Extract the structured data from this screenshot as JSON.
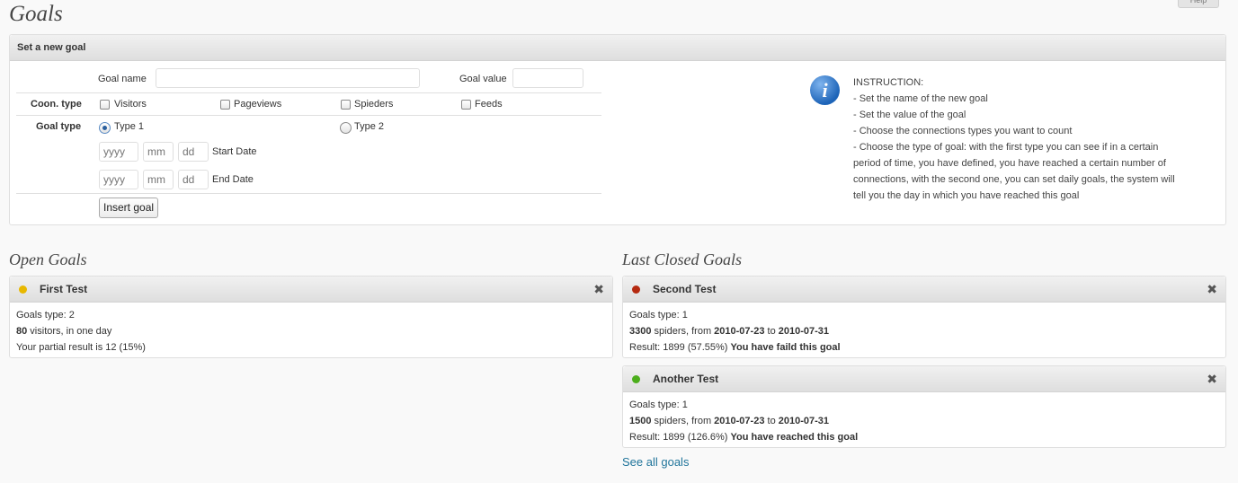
{
  "help_label": "Help",
  "page_title": "Goals",
  "new_goal": {
    "title": "Set a new goal",
    "goal_name_label": "Goal name",
    "goal_name_value": "",
    "goal_value_label": "Goal value",
    "goal_value_value": "",
    "conn_type_label": "Coon. type",
    "conn_types": [
      "Visitors",
      "Pageviews",
      "Spieders",
      "Feeds"
    ],
    "goal_type_label": "Goal type",
    "goal_types": [
      "Type 1",
      "Type 2"
    ],
    "selected_goal_type": "Type 1",
    "date_placeholders": {
      "year": "yyyy",
      "month": "mm",
      "day": "dd"
    },
    "start_date_label": "Start Date",
    "end_date_label": "End Date",
    "insert_button": "Insert goal",
    "instructions": [
      "INSTRUCTION:",
      "- Set the name of the new goal",
      "- Set the value of the goal",
      "- Choose the connections types you want to count",
      "- Choose the type of goal: with the first type you can see if in a certain",
      "period of time, you have defined, you have reached a certain number of",
      "connections, with the second one, you can set daily goals, the system will",
      "tell you the day in which you have reached this goal"
    ],
    "info_icon": "info-icon"
  },
  "open_goals": {
    "title": "Open Goals",
    "items": [
      {
        "name": "First Test",
        "status_color": "#e8b800",
        "type_line": "Goals type: 2",
        "value": "80",
        "value_rest": " visitors, in one day",
        "result_line": "Your partial result is 12 (15%)"
      }
    ]
  },
  "closed_goals": {
    "title": "Last Closed Goals",
    "items": [
      {
        "name": "Second Test",
        "status_color": "#b52a10",
        "type_line": "Goals type: 1",
        "value": "3300",
        "value_mid": " spiders, from ",
        "from": "2010-07-23",
        "to_word": " to ",
        "to": "2010-07-31",
        "result_prefix": "Result: 1899 (57.55%) ",
        "result_outcome": "You have faild this goal"
      },
      {
        "name": "Another Test",
        "status_color": "#4cae1c",
        "type_line": "Goals type: 1",
        "value": "1500",
        "value_mid": " spiders, from ",
        "from": "2010-07-23",
        "to_word": " to ",
        "to": "2010-07-31",
        "result_prefix": "Result: 1899 (126.6%) ",
        "result_outcome": "You have reached this goal"
      }
    ],
    "see_all": "See all goals"
  },
  "colors": {
    "link": "#21759b",
    "radio_selected": "#2a5f9e"
  }
}
